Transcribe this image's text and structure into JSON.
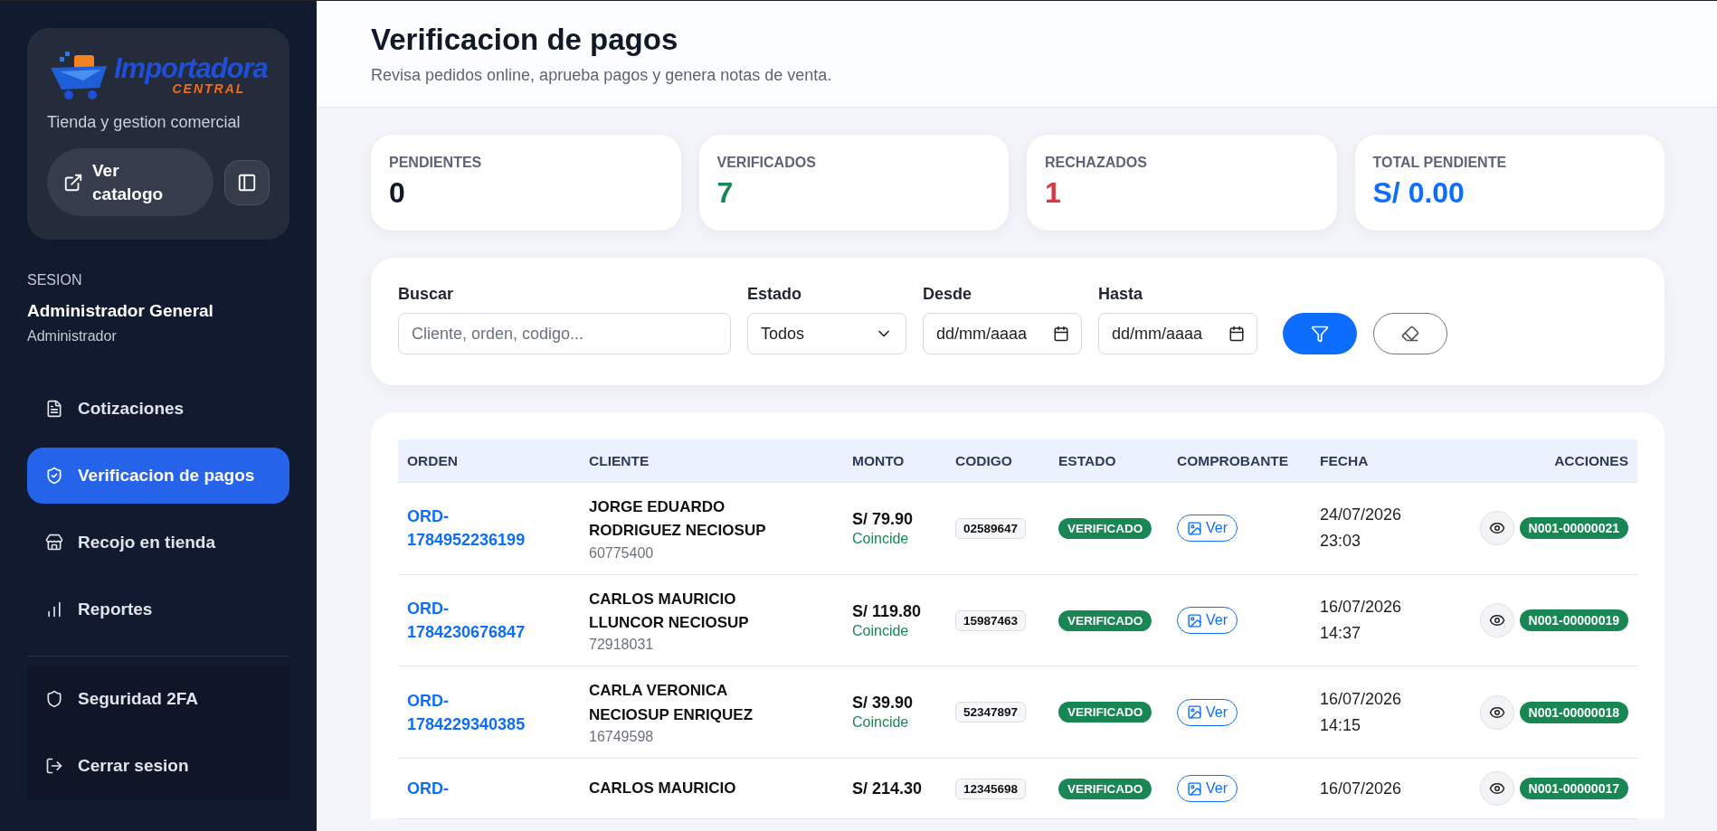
{
  "sidebar": {
    "logo": {
      "name": "Importadora",
      "tagline": "CENTRAL"
    },
    "subtitle": "Tienda y gestion comercial",
    "catalog_button": "Ver catalogo",
    "session": {
      "label": "SESION",
      "user": "Administrador General",
      "role": "Administrador"
    },
    "nav": [
      {
        "label": "Cotizaciones",
        "selected": false
      },
      {
        "label": "Verificacion de pagos",
        "selected": true
      },
      {
        "label": "Recojo en tienda",
        "selected": false
      },
      {
        "label": "Reportes",
        "selected": false
      }
    ],
    "footer": [
      {
        "label": "Seguridad 2FA"
      },
      {
        "label": "Cerrar sesion"
      }
    ]
  },
  "header": {
    "title": "Verificacion de pagos",
    "subtitle": "Revisa pedidos online, aprueba pagos y genera notas de venta."
  },
  "stats": [
    {
      "label": "PENDIENTES",
      "value": "0",
      "color": "#111827"
    },
    {
      "label": "VERIFICADOS",
      "value": "7",
      "color": "#198754"
    },
    {
      "label": "RECHAZADOS",
      "value": "1",
      "color": "#dc3545"
    },
    {
      "label": "TOTAL PENDIENTE",
      "value": "S/ 0.00",
      "color": "#0d6efd"
    }
  ],
  "filters": {
    "search": {
      "label": "Buscar",
      "placeholder": "Cliente, orden, codigo..."
    },
    "status": {
      "label": "Estado",
      "value": "Todos"
    },
    "from": {
      "label": "Desde",
      "placeholder": "dd/mm/aaaa"
    },
    "to": {
      "label": "Hasta",
      "placeholder": "dd/mm/aaaa"
    }
  },
  "table": {
    "columns": [
      "ORDEN",
      "CLIENTE",
      "MONTO",
      "CODIGO",
      "ESTADO",
      "COMPROBANTE",
      "FECHA",
      "ACCIONES"
    ],
    "rows": [
      {
        "order": "ORD-1784952236199",
        "client": "JORGE EDUARDO RODRIGUEZ NECIOSUP",
        "doc": "60775400",
        "amount": "S/ 79.90",
        "match": "Coincide",
        "code": "02589647",
        "status": "VERIFICADO",
        "receipt": "Ver",
        "date": "24/07/2026",
        "time": "23:03",
        "note": "N001-00000021"
      },
      {
        "order": "ORD-1784230676847",
        "client": "CARLOS MAURICIO LLUNCOR NECIOSUP",
        "doc": "72918031",
        "amount": "S/ 119.80",
        "match": "Coincide",
        "code": "15987463",
        "status": "VERIFICADO",
        "receipt": "Ver",
        "date": "16/07/2026",
        "time": "14:37",
        "note": "N001-00000019"
      },
      {
        "order": "ORD-1784229340385",
        "client": "CARLA VERONICA NECIOSUP ENRIQUEZ",
        "doc": "16749598",
        "amount": "S/ 39.90",
        "match": "Coincide",
        "code": "52347897",
        "status": "VERIFICADO",
        "receipt": "Ver",
        "date": "16/07/2026",
        "time": "14:15",
        "note": "N001-00000018"
      },
      {
        "order": "ORD-",
        "client": "CARLOS MAURICIO",
        "amount": "S/ 214.30",
        "code": "12345698",
        "status": "VERIFICADO",
        "receipt": "Ver",
        "date": "16/07/2026",
        "note": "N001-00000017"
      }
    ]
  }
}
